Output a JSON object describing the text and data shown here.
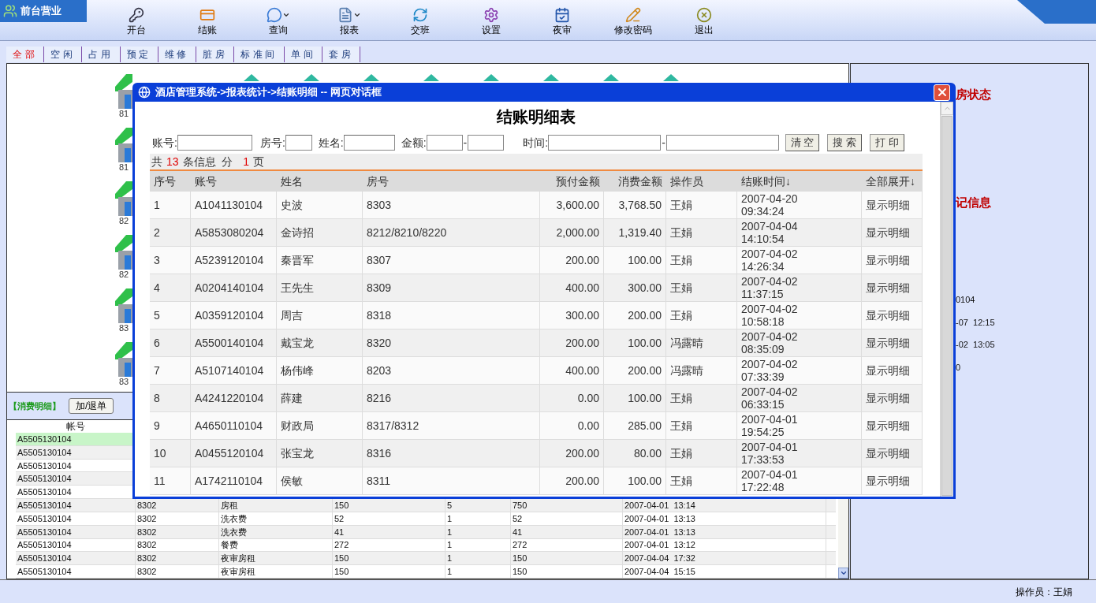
{
  "header": {
    "brand": "前台营业"
  },
  "toolbar": [
    {
      "label": "开台",
      "dropdown": false
    },
    {
      "label": "结账",
      "dropdown": false
    },
    {
      "label": "查询",
      "dropdown": true
    },
    {
      "label": "报表",
      "dropdown": true
    },
    {
      "label": "交班",
      "dropdown": false
    },
    {
      "label": "设置",
      "dropdown": false
    },
    {
      "label": "夜审",
      "dropdown": false
    },
    {
      "label": "修改密码",
      "dropdown": false
    },
    {
      "label": "退出",
      "dropdown": false
    }
  ],
  "room_tabs": [
    {
      "label": "全部",
      "selected": true
    },
    {
      "label": "空闲",
      "selected": false
    },
    {
      "label": "占用",
      "selected": false
    },
    {
      "label": "预定",
      "selected": false
    },
    {
      "label": "维修",
      "selected": false
    },
    {
      "label": "脏房",
      "selected": false
    },
    {
      "label": "标准间",
      "selected": false
    },
    {
      "label": "单间",
      "selected": false
    },
    {
      "label": "套房",
      "selected": false
    }
  ],
  "rooms": [
    {
      "label": "81"
    },
    {
      "label": "81"
    },
    {
      "label": "82"
    },
    {
      "label": "82"
    },
    {
      "label": "83"
    },
    {
      "label": "83"
    }
  ],
  "consumption": {
    "title": "【消费明细】",
    "button": "加/退单",
    "columns": [
      "帐号"
    ],
    "rows": [
      {
        "account": "A5505130104",
        "selected": true
      },
      {
        "account": "A5505130104",
        "selected": false
      },
      {
        "account": "A5505130104",
        "selected": false
      },
      {
        "account": "A5505130104",
        "selected": false
      },
      {
        "account": "A5505130104",
        "selected": false
      },
      {
        "account": "A5505130104",
        "room": "8302",
        "item": "房租",
        "price": "150",
        "qty": "5",
        "amount": "750",
        "time": "2007-04-01  13:14",
        "selected": false
      },
      {
        "account": "A5505130104",
        "room": "8302",
        "item": "洗衣费",
        "price": "52",
        "qty": "1",
        "amount": "52",
        "time": "2007-04-01  13:13",
        "selected": false
      },
      {
        "account": "A5505130104",
        "room": "8302",
        "item": "洗衣费",
        "price": "41",
        "qty": "1",
        "amount": "41",
        "time": "2007-04-01  13:13",
        "selected": false
      },
      {
        "account": "A5505130104",
        "room": "8302",
        "item": "餐费",
        "price": "272",
        "qty": "1",
        "amount": "272",
        "time": "2007-04-01  13:12",
        "selected": false
      },
      {
        "account": "A5505130104",
        "room": "8302",
        "item": "夜审房租",
        "price": "150",
        "qty": "1",
        "amount": "150",
        "time": "2007-04-04  17:32",
        "selected": false
      },
      {
        "account": "A5505130104",
        "room": "8302",
        "item": "夜审房租",
        "price": "150",
        "qty": "1",
        "amount": "150",
        "time": "2007-04-04  15:15",
        "selected": false
      }
    ]
  },
  "side_panel": {
    "lines": [
      {
        "kind": "title",
        "text": "房状态"
      },
      {
        "kind": "title",
        "text": "记信息"
      },
      {
        "kind": "text",
        "text": "0104"
      },
      {
        "kind": "text",
        "text": "-07  12:15"
      },
      {
        "kind": "text",
        "text": "-02  13:05"
      },
      {
        "kind": "text",
        "text": "0"
      }
    ]
  },
  "status_bar": {
    "operator": "操作员：王娟"
  },
  "dialog": {
    "title": "酒店管理系统->报表统计->结账明细  --  网页对话框",
    "heading": "结账明细表",
    "filters": [
      {
        "label": "账号:",
        "kind": "single"
      },
      {
        "label": "房号:",
        "kind": "single"
      },
      {
        "label": "姓名:",
        "kind": "single"
      },
      {
        "label": "金额:",
        "kind": "range",
        "separator": "-"
      },
      {
        "label": "时间:",
        "kind": "range",
        "separator": "-"
      }
    ],
    "buttons": [
      "清 空",
      "搜 索",
      "打 印"
    ],
    "summary": {
      "prefix": "共",
      "count": "13",
      "middle": "条信息  分",
      "pages": "1",
      "suffix": "页"
    },
    "columns": [
      "序号",
      "账号",
      "姓名",
      "房号",
      "预付金额",
      "消费金额",
      "操作员",
      "结账时间↓",
      "全部展开↓"
    ],
    "rows": [
      {
        "no": "1",
        "account": "A1041130104",
        "name": "史波",
        "room": "8303",
        "prepaid": "3,600.00",
        "spent": "3,768.50",
        "operator": "王娟",
        "time": "2007-04-20 09:34:24",
        "action": "显示明细"
      },
      {
        "no": "2",
        "account": "A5853080204",
        "name": "金诗招",
        "room": "8212/8210/8220",
        "prepaid": "2,000.00",
        "spent": "1,319.40",
        "operator": "王娟",
        "time": "2007-04-04 14:10:54",
        "action": "显示明细"
      },
      {
        "no": "3",
        "account": "A5239120104",
        "name": "秦晋军",
        "room": "8307",
        "prepaid": "200.00",
        "spent": "100.00",
        "operator": "王娟",
        "time": "2007-04-02 14:26:34",
        "action": "显示明细"
      },
      {
        "no": "4",
        "account": "A0204140104",
        "name": "王先生",
        "room": "8309",
        "prepaid": "400.00",
        "spent": "300.00",
        "operator": "王娟",
        "time": "2007-04-02 11:37:15",
        "action": "显示明细"
      },
      {
        "no": "5",
        "account": "A0359120104",
        "name": "周吉",
        "room": "8318",
        "prepaid": "300.00",
        "spent": "200.00",
        "operator": "王娟",
        "time": "2007-04-02 10:58:18",
        "action": "显示明细"
      },
      {
        "no": "6",
        "account": "A5500140104",
        "name": "戴宝龙",
        "room": "8320",
        "prepaid": "200.00",
        "spent": "100.00",
        "operator": "冯露晴",
        "time": "2007-04-02 08:35:09",
        "action": "显示明细"
      },
      {
        "no": "7",
        "account": "A5107140104",
        "name": "杨伟峰",
        "room": "8203",
        "prepaid": "400.00",
        "spent": "200.00",
        "operator": "冯露晴",
        "time": "2007-04-02 07:33:39",
        "action": "显示明细"
      },
      {
        "no": "8",
        "account": "A4241220104",
        "name": "薛建",
        "room": "8216",
        "prepaid": "0.00",
        "spent": "100.00",
        "operator": "王娟",
        "time": "2007-04-02 06:33:15",
        "action": "显示明细"
      },
      {
        "no": "9",
        "account": "A4650110104",
        "name": "财政局",
        "room": "8317/8312",
        "prepaid": "0.00",
        "spent": "285.00",
        "operator": "王娟",
        "time": "2007-04-01 19:54:25",
        "action": "显示明细"
      },
      {
        "no": "10",
        "account": "A0455120104",
        "name": "张宝龙",
        "room": "8316",
        "prepaid": "200.00",
        "spent": "80.00",
        "operator": "王娟",
        "time": "2007-04-01 17:33:53",
        "action": "显示明细"
      },
      {
        "no": "11",
        "account": "A1742110104",
        "name": "侯敏",
        "room": "8311",
        "prepaid": "200.00",
        "spent": "100.00",
        "operator": "王娟",
        "time": "2007-04-01 17:22:48",
        "action": "显示明细"
      }
    ]
  }
}
